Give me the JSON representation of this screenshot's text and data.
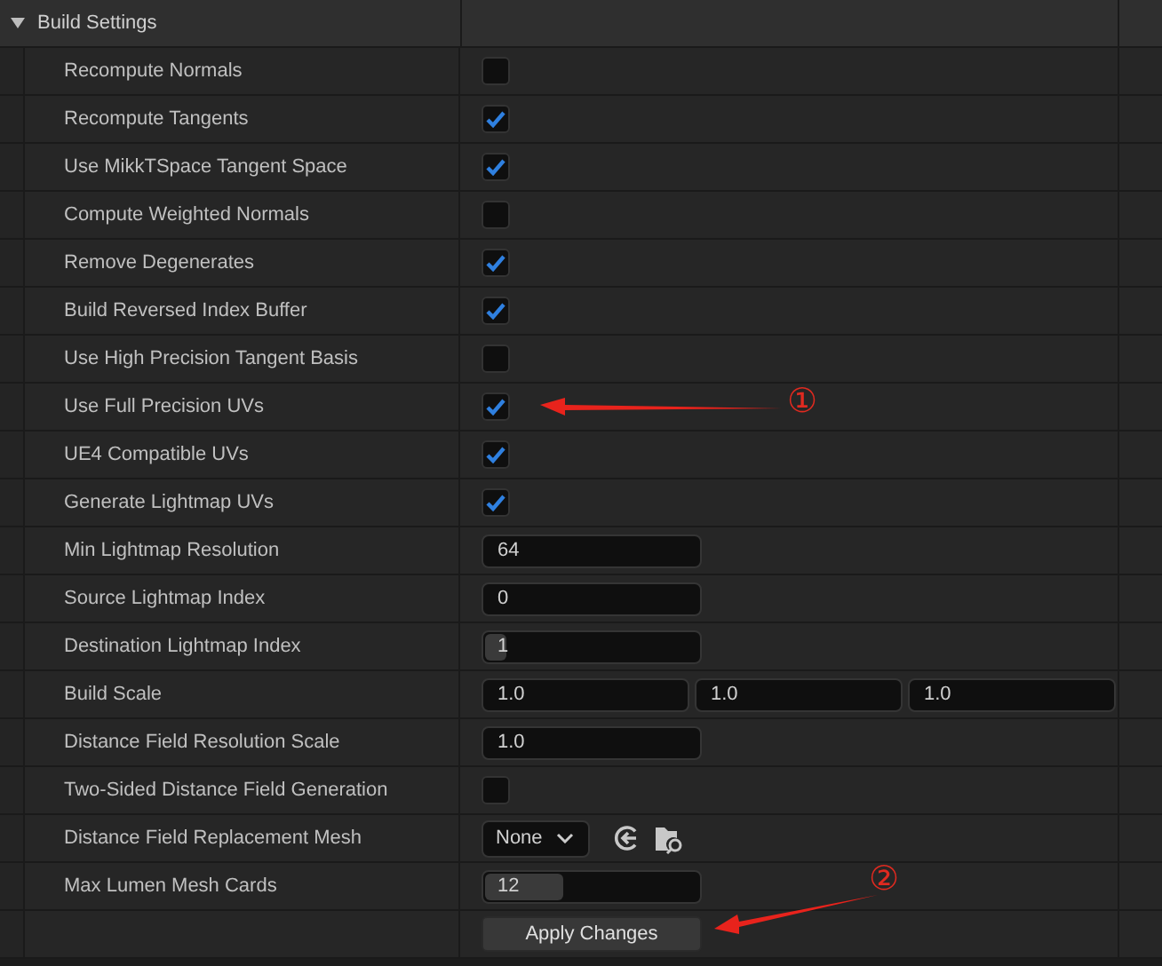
{
  "section": {
    "title": "Build Settings",
    "expanded": true
  },
  "rows": [
    {
      "label": "Recompute Normals",
      "kind": "checkbox",
      "checked": false
    },
    {
      "label": "Recompute Tangents",
      "kind": "checkbox",
      "checked": true
    },
    {
      "label": "Use MikkTSpace Tangent Space",
      "kind": "checkbox",
      "checked": true
    },
    {
      "label": "Compute Weighted Normals",
      "kind": "checkbox",
      "checked": false
    },
    {
      "label": "Remove Degenerates",
      "kind": "checkbox",
      "checked": true
    },
    {
      "label": "Build Reversed Index Buffer",
      "kind": "checkbox",
      "checked": true
    },
    {
      "label": "Use High Precision Tangent Basis",
      "kind": "checkbox",
      "checked": false
    },
    {
      "label": "Use Full Precision UVs",
      "kind": "checkbox",
      "checked": true
    },
    {
      "label": "UE4 Compatible UVs",
      "kind": "checkbox",
      "checked": true
    },
    {
      "label": "Generate Lightmap UVs",
      "kind": "checkbox",
      "checked": true
    },
    {
      "label": "Min Lightmap Resolution",
      "kind": "number",
      "value": "64"
    },
    {
      "label": "Source Lightmap Index",
      "kind": "number",
      "value": "0"
    },
    {
      "label": "Destination Lightmap Index",
      "kind": "slider",
      "value": "1",
      "level": 0.1
    },
    {
      "label": "Build Scale",
      "kind": "vector",
      "values": [
        "1.0",
        "1.0",
        "1.0"
      ]
    },
    {
      "label": "Distance Field Resolution Scale",
      "kind": "number",
      "value": "1.0"
    },
    {
      "label": "Two-Sided Distance Field Generation",
      "kind": "checkbox",
      "checked": false
    },
    {
      "label": "Distance Field Replacement Mesh",
      "kind": "asset",
      "value": "None"
    },
    {
      "label": "Max Lumen Mesh Cards",
      "kind": "slider",
      "value": "12",
      "level": 0.36
    },
    {
      "kind": "button",
      "value": "Apply Changes"
    }
  ],
  "annotations": [
    {
      "label": "①"
    },
    {
      "label": "②"
    }
  ]
}
